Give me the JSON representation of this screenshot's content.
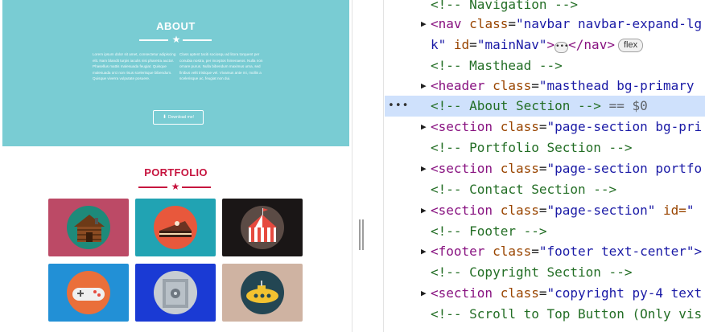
{
  "preview": {
    "about": {
      "title": "ABOUT",
      "star": "★",
      "col1": "Lorem ipsum dolor sit amet, consectetur adipiscing elit. Nam blandit turpis iaculis nisi pharetra auctor. Phasellus mattis malesuada feugiat. Quisque malesuada orci non risus scelerisque bibendum. Quisque viverra vulputate posuere.",
      "col2": "Class aptent taciti sociosqu ad litora torquent per conubia nostra, per inceptos himenaeos. Nulla non ornare purus. Nulla bibendum maximus urna, sed finibus velit tristique vel. Vivamus ante mi, mollis a scelerisque ac, feugiat non dui.",
      "download_icon": "⬇",
      "download_label": "Download me!"
    },
    "portfolio": {
      "title": "PORTFOLIO",
      "star": "★",
      "tiles": [
        {
          "name": "cabin",
          "bg": "#bc4a66",
          "circle": "#1e8a7a"
        },
        {
          "name": "cake",
          "bg": "#21a3b3",
          "circle": "#e8583c"
        },
        {
          "name": "circus",
          "bg": "#1a1616",
          "circle": "#5b4b45"
        },
        {
          "name": "game",
          "bg": "#2290d6",
          "circle": "#ea6f3a"
        },
        {
          "name": "safe",
          "bg": "#1a3ad4",
          "circle": "#c7cdd2"
        },
        {
          "name": "submarine",
          "bg": "#cfb3a2",
          "circle": "#234653"
        }
      ]
    }
  },
  "devtools": {
    "lines": [
      {
        "type": "comment",
        "text": "<!-- Navigation -->"
      },
      {
        "type": "nav",
        "toggle": "▶",
        "tag_open": "<nav",
        "attr1_name": "class",
        "attr1_value": "\"navbar navbar-expand-lg",
        "cont_value": "k\"",
        "attr2_name": "id",
        "attr2_value": "\"mainNav\"",
        "ellipsis": "•••",
        "tag_close": "</nav>",
        "badge": "flex"
      },
      {
        "type": "comment",
        "text": "<!-- Masthead -->"
      },
      {
        "type": "element",
        "toggle": "▶",
        "tag": "<header",
        "attr_name": "class",
        "attr_value": "\"masthead bg-primary"
      },
      {
        "type": "selected",
        "dots": "•••",
        "text": "<!-- About Section -->",
        "suffix": "== $0"
      },
      {
        "type": "element",
        "toggle": "▶",
        "tag": "<section",
        "attr_name": "class",
        "attr_value": "\"page-section bg-pri"
      },
      {
        "type": "comment",
        "text": "<!-- Portfolio Section -->"
      },
      {
        "type": "element",
        "toggle": "▶",
        "tag": "<section",
        "attr_name": "class",
        "attr_value": "\"page-section portfo"
      },
      {
        "type": "comment",
        "text": "<!-- Contact Section -->"
      },
      {
        "type": "element2",
        "toggle": "▶",
        "tag": "<section",
        "attr_name": "class",
        "attr_value": "\"page-section\"",
        "attr2_name": "id=",
        "attr2_value": "\""
      },
      {
        "type": "comment",
        "text": "<!-- Footer -->"
      },
      {
        "type": "element",
        "toggle": "▶",
        "tag": "<footer",
        "attr_name": "class",
        "attr_value": "\"footer text-center\">"
      },
      {
        "type": "comment",
        "text": "<!-- Copyright Section -->"
      },
      {
        "type": "element",
        "toggle": "▶",
        "tag": "<section",
        "attr_name": "class",
        "attr_value": "\"copyright py-4 text"
      },
      {
        "type": "comment",
        "text": "<!-- Scroll to Top Button (Only vis"
      }
    ]
  }
}
